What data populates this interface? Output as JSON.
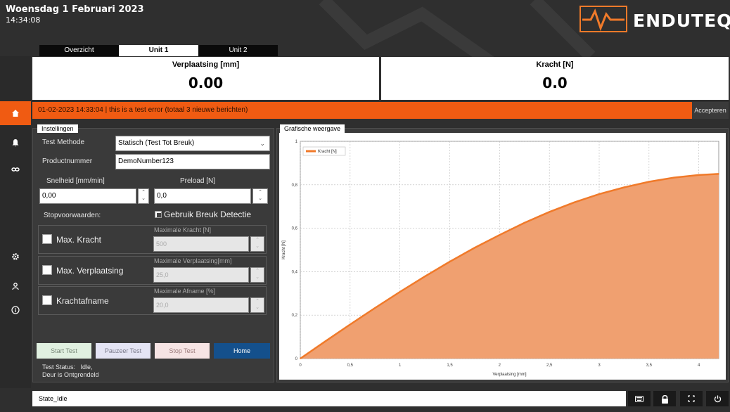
{
  "header": {
    "date": "Woensdag 1 Februari 2023",
    "time": "14:34:08",
    "brand": "ENDUTEQ"
  },
  "tabs": [
    {
      "label": "Overzicht",
      "active": false
    },
    {
      "label": "Unit 1",
      "active": true
    },
    {
      "label": "Unit 2",
      "active": false
    }
  ],
  "sidebar": [
    {
      "icon": "home-icon",
      "active": true
    },
    {
      "icon": "bell-icon",
      "active": false
    },
    {
      "icon": "link-icon",
      "active": false
    },
    {
      "icon": "gear-icon",
      "active": false
    },
    {
      "icon": "user-icon",
      "active": false
    },
    {
      "icon": "info-icon",
      "active": false
    }
  ],
  "readouts": {
    "displacement": {
      "label": "Verplaatsing [mm]",
      "value": "0.00"
    },
    "force": {
      "label": "Kracht [N]",
      "value": "0.0"
    }
  },
  "alert": {
    "message": "01-02-2023 14:33:04 | this is a test error (totaal 3 nieuwe berichten)",
    "accept_label": "Accepteren"
  },
  "settings": {
    "title": "Instellingen",
    "test_method_label": "Test Methode",
    "test_method_value": "Statisch (Test Tot Breuk)",
    "product_label": "Productnummer",
    "product_value": "DemoNumber123",
    "speed_label": "Snelheid [mm/min]",
    "speed_value": "0,00",
    "preload_label": "Preload [N]",
    "preload_value": "0,0",
    "stop_label": "Stopvoorwaarden:",
    "break_detect_label": "Gebruik Breuk Detectie",
    "break_detect_checked": true,
    "conditions": [
      {
        "label": "Max. Kracht",
        "field_label": "Maximale Kracht [N]",
        "value": "500"
      },
      {
        "label": "Max. Verplaatsing",
        "field_label": "Maximale Verplaatsing[mm]",
        "value": "25,0"
      },
      {
        "label": "Krachtafname",
        "field_label": "Maximale Afname [%]",
        "value": "20,0"
      }
    ],
    "buttons": {
      "start": "Start Test",
      "pause": "Pauzeer Test",
      "stop": "Stop Test",
      "home": "Home"
    },
    "status_line1": "Test Status:   Idle,",
    "status_line2": "Deur is Ontgrendeld"
  },
  "chart_panel": {
    "title": "Grafische weergave"
  },
  "chart_data": {
    "type": "area",
    "xlabel": "Verplaatsing [mm]",
    "ylabel": "Kracht [N]",
    "series": [
      {
        "name": "Kracht [N]",
        "color": "#f07a2a",
        "x": [
          0,
          0.25,
          0.5,
          0.75,
          1.0,
          1.25,
          1.5,
          1.75,
          2.0,
          2.25,
          2.5,
          2.75,
          3.0,
          3.25,
          3.5,
          3.75,
          4.0,
          4.2
        ],
        "y": [
          0,
          0.079,
          0.157,
          0.233,
          0.307,
          0.378,
          0.446,
          0.51,
          0.569,
          0.625,
          0.675,
          0.719,
          0.757,
          0.788,
          0.814,
          0.833,
          0.845,
          0.85
        ]
      }
    ],
    "xlim": [
      0,
      4.2
    ],
    "ylim": [
      0,
      1
    ],
    "xticks": [
      "0",
      "0,5",
      "1",
      "1,5",
      "2",
      "2,5",
      "3",
      "3,5",
      "4"
    ],
    "yticks": [
      "0",
      "0,2",
      "0,4",
      "0,6",
      "0,8",
      "1"
    ],
    "grid": true,
    "legend": "top-left"
  },
  "status_bar": {
    "text": "State_Idle",
    "buttons": [
      "keyboard-icon",
      "lock-icon",
      "fullscreen-icon",
      "power-icon"
    ]
  }
}
